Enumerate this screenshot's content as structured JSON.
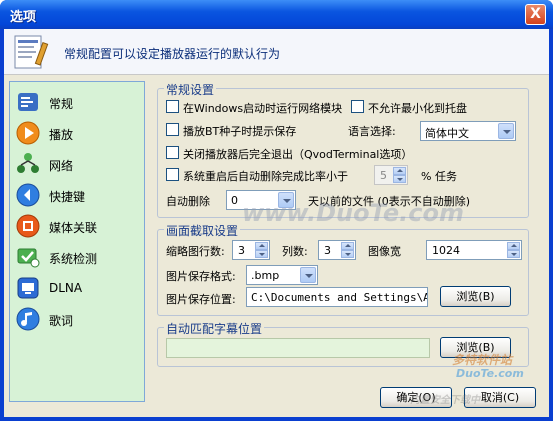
{
  "window": {
    "title": "选项",
    "close_glyph": "X"
  },
  "header": {
    "description": "常规配置可以设定播放器运行的默认行为",
    "icon": "settings-document-icon"
  },
  "sidebar": {
    "items": [
      {
        "label": "常规",
        "icon": "general-icon"
      },
      {
        "label": "播放",
        "icon": "play-icon"
      },
      {
        "label": "网络",
        "icon": "network-icon"
      },
      {
        "label": "快捷键",
        "icon": "shortcut-icon"
      },
      {
        "label": "媒体关联",
        "icon": "media-association-icon"
      },
      {
        "label": "系统检测",
        "icon": "system-check-icon"
      },
      {
        "label": "DLNA",
        "icon": "dlna-icon"
      },
      {
        "label": "歌词",
        "icon": "lyrics-icon"
      }
    ]
  },
  "general": {
    "title": "常规设置",
    "startup_network": "在Windows启动时运行网络模块",
    "no_minimize_tray": "不允许最小化到托盘",
    "bt_prompt": "播放BT种子时提示保存",
    "language_label": "语言选择:",
    "language_value": "简体中文",
    "exit_fully": "关闭播放器后完全退出（QvodTerminal选项）",
    "restart_delete": "系统重启后自动删除完成比率小于",
    "restart_value": "5",
    "restart_suffix": "% 任务",
    "auto_delete_label": "自动删除",
    "auto_delete_value": "0",
    "auto_delete_suffix": "天以前的文件  (0表示不自动删除)"
  },
  "capture": {
    "title": "画面截取设置",
    "thumb_rows_label": "缩略图行数:",
    "thumb_rows_value": "3",
    "cols_label": "列数:",
    "cols_value": "3",
    "width_label": "图像宽",
    "width_value": "1024",
    "format_label": "图片保存格式:",
    "format_value": ".bmp",
    "path_label": "图片保存位置:",
    "path_value": "C:\\Documents and Settings\\Admi",
    "browse_label": "浏览(B)"
  },
  "subtitle": {
    "title": "自动匹配字幕位置",
    "path_value": "",
    "browse_label": "浏览(B)"
  },
  "footer": {
    "ok_label": "确定(O)",
    "cancel_label": "取消(C)"
  },
  "watermarks": {
    "center": "www.DuoTe.com",
    "corner_cn": "多特软件站",
    "corner_en": "DuoTe.com",
    "corner_bottom": "内置安全下载中"
  },
  "colors": {
    "title_bar": "#0a55e0",
    "sidebar_bg": "#d7f2d6",
    "dialog_bg": "#ece9d8",
    "group_title": "#1a3d8a"
  }
}
